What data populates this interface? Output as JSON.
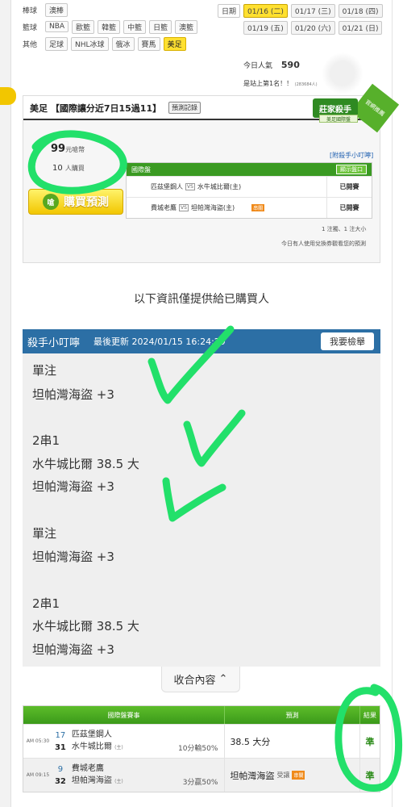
{
  "nav": {
    "rows": [
      {
        "label": "棒球",
        "items": [
          "澳棒"
        ]
      },
      {
        "label": "籃球",
        "items": [
          "NBA",
          "歐籃",
          "韓籃",
          "中籃",
          "日籃",
          "澳籃"
        ]
      },
      {
        "label": "其他",
        "items": [
          "足球",
          "NHL冰球",
          "俄冰",
          "賽馬",
          "美足"
        ]
      }
    ],
    "active_item": "美足",
    "date_label": "日期",
    "dates": [
      "01/16 (二)",
      "01/17 (三)",
      "01/18 (四)",
      "01/19 (五)",
      "01/20 (六)",
      "01/21 (日)"
    ],
    "active_date": "01/16 (二)"
  },
  "stats": {
    "popularity_label": "今日人氣",
    "popularity_value": "590",
    "rank_text": "是站上第1名！！",
    "rank_small": "(283684人)"
  },
  "card": {
    "title": "美足 【國際讓分近7日15過11】",
    "record_button": "預測記錄",
    "badge_logo": "莊家殺手",
    "badge_sub": "美足國際盤",
    "ribbon": "官網推薦",
    "price": "99",
    "price_unit": "元嗆幣",
    "buyers": "10",
    "buyers_unit": "人購買",
    "buy_button": "購買預測",
    "buy_icon": "嗆",
    "tips_link": "[附殺手小叮嚀]",
    "mini_table": {
      "header": "國際盤",
      "show_button": "顯示盤口",
      "rows": [
        {
          "away": "匹茲堡鋼人",
          "vs": "VS",
          "home": "水牛城比爾(主)",
          "tag": "",
          "status": "已開賽"
        },
        {
          "away": "費城老鷹",
          "vs": "VS",
          "home": "坦帕灣海盜(主)",
          "tag": "串關",
          "status": "已開賽"
        }
      ]
    },
    "footnote1": "1 注獨、1 注大小",
    "footnote2": "今日有人使用兌換券觀看您的預測"
  },
  "info_line": "以下資訊僅提供給已購買人",
  "tips": {
    "title": "殺手小叮嚀",
    "updated": "最後更新 2024/01/15 16:24:29",
    "report_button": "我要檢舉",
    "lines": [
      "單注",
      "坦帕灣海盜 +3",
      "",
      "2串1",
      "水牛城比爾 38.5 大",
      "坦帕灣海盜 +3",
      "",
      "單注",
      "坦帕灣海盜 +3",
      "",
      "2串1",
      "水牛城比爾 38.5 大",
      "坦帕灣海盜 +3"
    ],
    "collapse_button": "收合內容"
  },
  "result_table": {
    "headers": [
      "國際盤賽事",
      "預測",
      "結果"
    ],
    "rows": [
      {
        "time": "AM 05:30",
        "num_away": "17",
        "num_home": "31",
        "away": "匹茲堡鋼人",
        "home": "水牛城比爾",
        "home_mark": "(主)",
        "odds": "10分輸50%",
        "pick": "38.5 大分",
        "pick_sub": "",
        "pick_tag": "",
        "result": "準"
      },
      {
        "time": "AM 09:15",
        "num_away": "9",
        "num_home": "32",
        "away": "費城老鷹",
        "home": "坦帕灣海盜",
        "home_mark": "(主)",
        "odds": "3分贏50%",
        "pick": "坦帕灣海盜",
        "pick_sub": "受讓",
        "pick_tag": "串關",
        "result": "準"
      }
    ]
  },
  "colors": {
    "accent_green": "#3b9a1a",
    "tips_blue": "#2c6fa5",
    "highlight_yellow": "#ffe030",
    "ink_green": "#22e06a"
  }
}
